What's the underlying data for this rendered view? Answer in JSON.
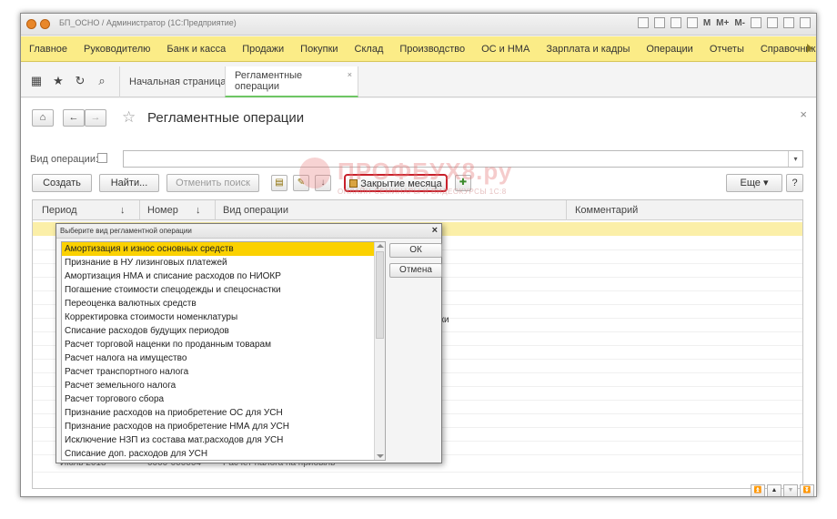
{
  "window": {
    "title": "БП_ОСНО / Администратор  (1С:Предприятие)",
    "toolbar_right": [
      "M",
      "M+",
      "M-"
    ]
  },
  "sections": [
    "Главное",
    "Руководителю",
    "Банк и касса",
    "Продажи",
    "Покупки",
    "Склад",
    "Производство",
    "ОС и НМА",
    "Зарплата и кадры",
    "Операции",
    "Отчеты",
    "Справочники"
  ],
  "tabs": {
    "home": "Начальная страница",
    "active": "Регламентные операции"
  },
  "form": {
    "title": "Регламентные операции",
    "operation_label": "Вид операции:",
    "buttons": {
      "create": "Создать",
      "find": "Найти...",
      "cancel_search": "Отменить поиск",
      "close_month": "Закрытие месяца",
      "more": "Еще",
      "help": "?"
    },
    "columns": [
      "Период",
      "Номер",
      "Вид операции",
      "Комментарий"
    ],
    "partial_cell": "тки",
    "last_row": {
      "period": "Июль 2018",
      "number": "0000-000004",
      "operation": "Расчет налога на прибыль"
    }
  },
  "watermark": {
    "text": "ПРОФБУХ8.ру",
    "sub": "ОНЛАЙН-СЕМИНАРЫ И ВИДЕОКУРСЫ 1С:8"
  },
  "dialog": {
    "title": "Выберите вид регламентной операции",
    "ok": "ОК",
    "cancel": "Отмена",
    "items": [
      "Амортизация и износ основных средств",
      "Признание в НУ лизинговых платежей",
      "Амортизация НМА и списание расходов по НИОКР",
      "Погашение стоимости спецодежды и спецоснастки",
      "Переоценка валютных средств",
      "Корректировка стоимости номенклатуры",
      "Списание расходов будущих периодов",
      "Расчет торговой наценки по проданным товарам",
      "Расчет налога на имущество",
      "Расчет транспортного налога",
      "Расчет земельного налога",
      "Расчет торгового сбора",
      "Признание расходов на приобретение ОС для УСН",
      "Признание расходов на приобретение НМА для УСН",
      "Исключение НЗП из состава мат.расходов для УСН",
      "Списание доп. расходов для УСН"
    ],
    "selected_index": 0
  },
  "colors": {
    "sections_bg": "#fbec87",
    "selection": "#fbd100",
    "highlight_border": "#c8202b",
    "active_tab_underline": "#6ec664"
  }
}
